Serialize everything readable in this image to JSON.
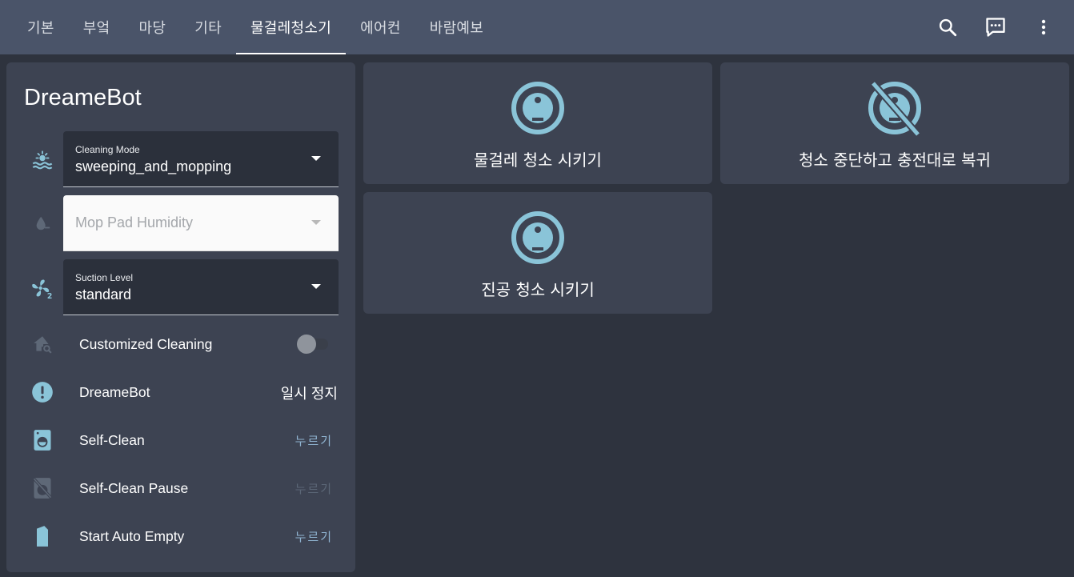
{
  "tabs": [
    {
      "label": "기본"
    },
    {
      "label": "부엌"
    },
    {
      "label": "마당"
    },
    {
      "label": "기타"
    },
    {
      "label": "물걸레청소기"
    },
    {
      "label": "에어컨"
    },
    {
      "label": "바람예보"
    }
  ],
  "active_tab_index": 4,
  "header_icons": [
    "search-icon",
    "chat-icon",
    "more-vert-icon"
  ],
  "entities": {
    "title": "DreameBot",
    "cleaning_mode": {
      "label": "Cleaning Mode",
      "value": "sweeping_and_mopping"
    },
    "mop_humidity": {
      "placeholder": "Mop Pad Humidity"
    },
    "suction_level": {
      "label": "Suction Level",
      "value": "standard"
    },
    "customized_cleaning": {
      "name": "Customized Cleaning",
      "on": false
    },
    "status": {
      "name": "DreameBot",
      "state": "일시 정지"
    },
    "self_clean": {
      "name": "Self-Clean",
      "action": "누르기"
    },
    "self_clean_pause": {
      "name": "Self-Clean Pause",
      "action": "누르기"
    },
    "auto_empty": {
      "name": "Start Auto Empty",
      "action": "누르기"
    }
  },
  "buttons": [
    {
      "label": "물걸레 청소 시키기",
      "icon": "robot-vacuum-icon"
    },
    {
      "label": "청소 중단하고 충전대로 복귀",
      "icon": "robot-vacuum-off-icon"
    },
    {
      "label": "진공 청소 시키기",
      "icon": "robot-vacuum-icon"
    }
  ],
  "colors": {
    "topbar": "#4a5469",
    "background": "#2e333e",
    "card": "#3d4352",
    "icon": "#8ac4d8"
  }
}
